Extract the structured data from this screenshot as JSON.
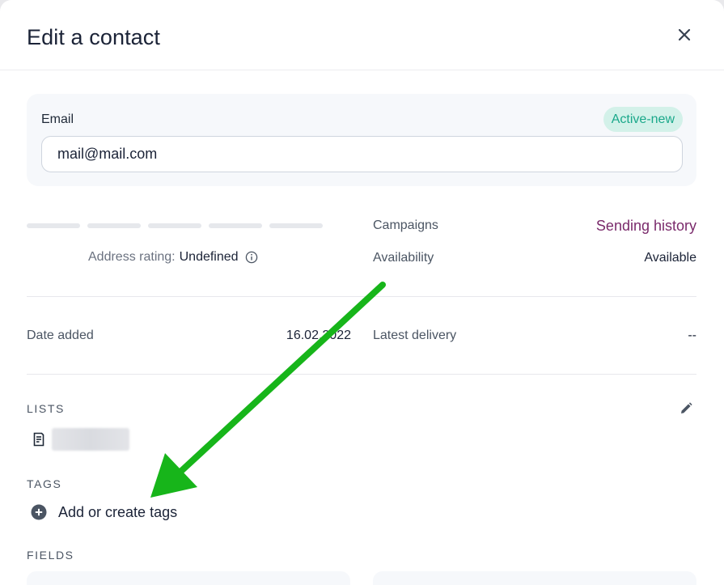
{
  "modal": {
    "title": "Edit a contact",
    "close_icon": "close-icon"
  },
  "email": {
    "label": "Email",
    "status": "Active-new",
    "value": "mail@mail.com"
  },
  "rating": {
    "label": "Address rating:",
    "value": "Undefined",
    "icon": "info-icon",
    "level": 0
  },
  "campaigns": {
    "label": "Campaigns",
    "link": "Sending history"
  },
  "availability": {
    "label": "Availability",
    "value": "Available"
  },
  "date_added": {
    "label": "Date added",
    "value": "16.02.2022"
  },
  "latest_delivery": {
    "label": "Latest delivery",
    "value": "--"
  },
  "lists": {
    "title": "LISTS",
    "edit_icon": "pencil-icon",
    "item_icon": "list-document-icon"
  },
  "tags": {
    "title": "TAGS",
    "add_label": "Add or create tags",
    "add_icon": "plus-circle-icon"
  },
  "fields": {
    "title": "FIELDS"
  },
  "annotation": {
    "icon": "green-arrow-icon",
    "color": "#17b51a"
  },
  "colors": {
    "title": "#1b2337",
    "badge_bg": "#d3f1e9",
    "badge_text": "#1aa88a",
    "link": "#7a2a6b",
    "card_bg": "#f6f8fb"
  }
}
